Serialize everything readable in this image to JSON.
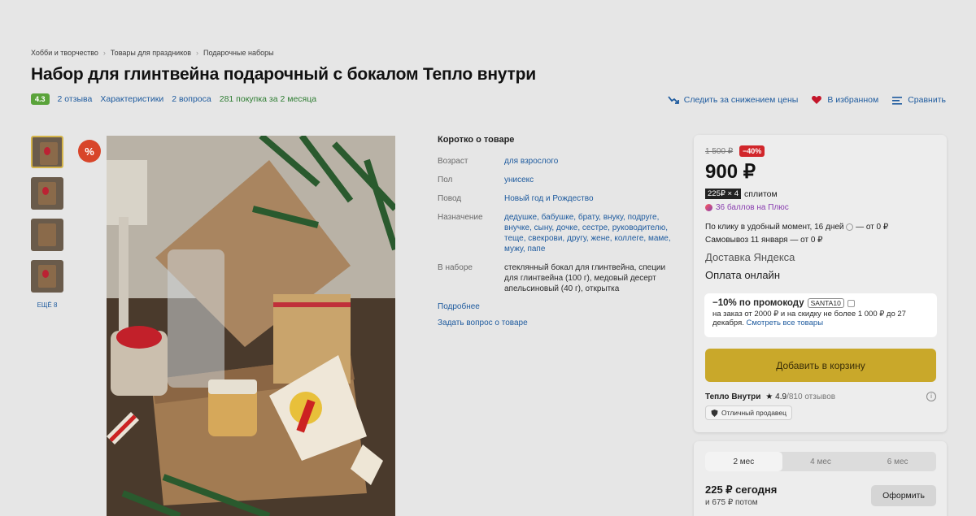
{
  "breadcrumbs": [
    "Хобби и творчество",
    "Товары для праздников",
    "Подарочные наборы"
  ],
  "breadcrumb_sep": "›",
  "title": "Набор для глинтвейна подарочный с бокалом Тепло внутри",
  "meta": {
    "rating": "4.3",
    "reviews": "2 отзыва",
    "characteristics": "Характеристики",
    "questions": "2 вопроса",
    "purchases": "281 покупка за 2 месяца"
  },
  "actions": {
    "track_price": "Следить за снижением цены",
    "favorites": "В избранном",
    "compare": "Сравнить"
  },
  "gallery": {
    "more_label": "ЕЩЁ 8",
    "sale_badge": "%"
  },
  "short": {
    "heading": "Коротко о товаре",
    "specs": [
      {
        "k": "Возраст",
        "v": "для взрослого"
      },
      {
        "k": "Пол",
        "v": "унисекс"
      },
      {
        "k": "Повод",
        "v": "Новый год и Рождество"
      },
      {
        "k": "Назначение",
        "v": "дедушке, бабушке, брату, внуку, подруге, внучке, сыну, дочке, сестре, руководителю, теще, свекрови, другу, жене, коллеге, маме, мужу, папе"
      },
      {
        "k": "В наборе",
        "v": "стеклянный бокал для глинтвейна, специи для глинтвейна (100 г), медовый десерт апельсиновый (40 г), открытка"
      }
    ],
    "more_link": "Подробнее",
    "ask_link": "Задать вопрос о товаре"
  },
  "buy": {
    "old_price": "1 500 ₽",
    "discount": "−40%",
    "price": "900 ₽",
    "split_pill": "225₽ × 4",
    "split_text": "сплитом",
    "plus": "36 баллов на Плюс",
    "delivery_1": "По клику в удобный момент, 16 дней",
    "delivery_1_price": "— от 0 ₽",
    "delivery_2": "Самовывоз 11 января — от 0 ₽",
    "ya_delivery": "Доставка Яндекса",
    "pay": "Оплата онлайн"
  },
  "promo": {
    "title": "−10% по промокоду",
    "code": "SANTA10",
    "text": "на заказ от 2000 ₽ и на скидку не более 1 000 ₽ до 27 декабря.",
    "link": "Смотреть все товары"
  },
  "cart_button": "Добавить в корзину",
  "seller": {
    "name": "Тепло Внутри",
    "rating": "★ 4.9",
    "reviews": "/810 отзывов",
    "badge": "Отличный продавец"
  },
  "split_box": {
    "tabs": [
      "2 мес",
      "4 мес",
      "6 мес"
    ],
    "today": "225 ₽ сегодня",
    "then": "и 675 ₽ потом",
    "order_button": "Оформить"
  },
  "colors": {
    "link": "#1d5a9e",
    "rating": "#5aa33a",
    "discount": "#d1262b",
    "cart": "#c9a82a"
  }
}
